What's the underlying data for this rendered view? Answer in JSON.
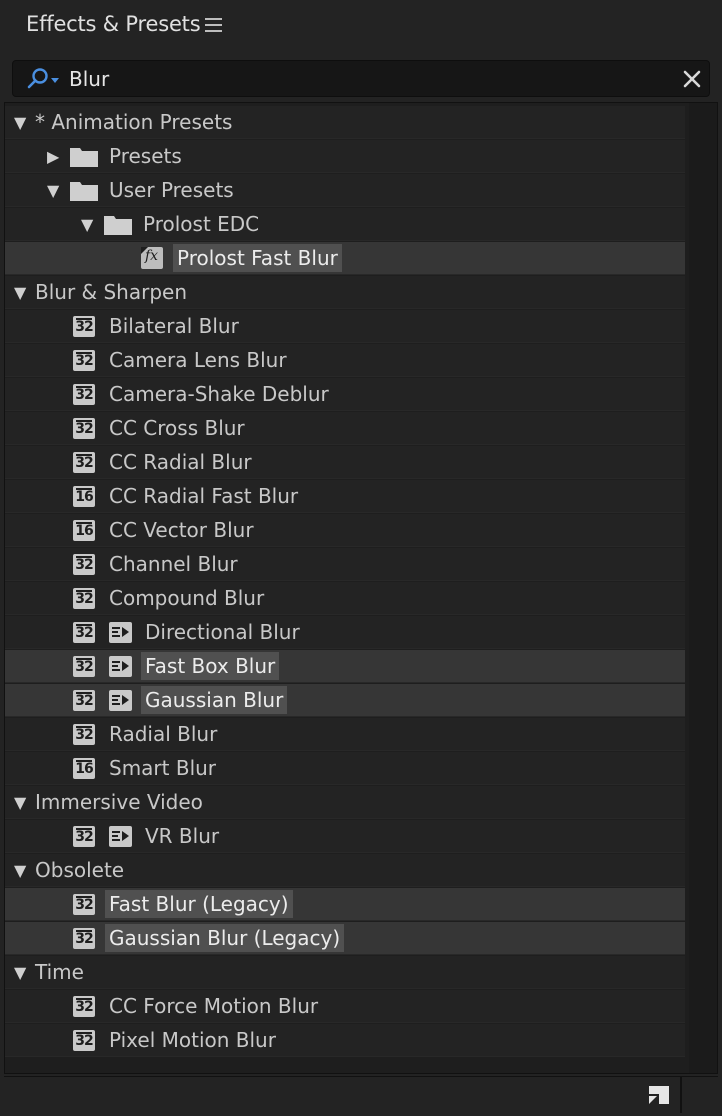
{
  "panel": {
    "title": "Effects & Presets",
    "menu_icon": "hamburger-icon"
  },
  "search": {
    "value": "Blur",
    "icon": "magnifier-dropdown-icon",
    "clear_icon": "close-icon"
  },
  "tree": [
    {
      "kind": "category",
      "label": "* Animation Presets",
      "expanded": true
    },
    {
      "kind": "folder",
      "label": "Presets",
      "expanded": false,
      "depth": 1
    },
    {
      "kind": "folder",
      "label": "User Presets",
      "expanded": true,
      "depth": 1
    },
    {
      "kind": "folder",
      "label": "Prolost EDC",
      "expanded": true,
      "depth": 2
    },
    {
      "kind": "preset",
      "label": "Prolost Fast Blur",
      "depth": 3,
      "selected": true
    },
    {
      "kind": "category",
      "label": "Blur & Sharpen",
      "expanded": true
    },
    {
      "kind": "effect",
      "label": "Bilateral Blur",
      "bpc": "32",
      "gpu": false
    },
    {
      "kind": "effect",
      "label": "Camera Lens Blur",
      "bpc": "32",
      "gpu": false
    },
    {
      "kind": "effect",
      "label": "Camera-Shake Deblur",
      "bpc": "32",
      "gpu": false
    },
    {
      "kind": "effect",
      "label": "CC Cross Blur",
      "bpc": "32",
      "gpu": false
    },
    {
      "kind": "effect",
      "label": "CC Radial Blur",
      "bpc": "32",
      "gpu": false
    },
    {
      "kind": "effect",
      "label": "CC Radial Fast Blur",
      "bpc": "16",
      "gpu": false
    },
    {
      "kind": "effect",
      "label": "CC Vector Blur",
      "bpc": "16",
      "gpu": false
    },
    {
      "kind": "effect",
      "label": "Channel Blur",
      "bpc": "32",
      "gpu": false
    },
    {
      "kind": "effect",
      "label": "Compound Blur",
      "bpc": "32",
      "gpu": false
    },
    {
      "kind": "effect",
      "label": "Directional Blur",
      "bpc": "32",
      "gpu": true
    },
    {
      "kind": "effect",
      "label": "Fast Box Blur",
      "bpc": "32",
      "gpu": true,
      "selected": true
    },
    {
      "kind": "effect",
      "label": "Gaussian Blur",
      "bpc": "32",
      "gpu": true,
      "selected": true
    },
    {
      "kind": "effect",
      "label": "Radial Blur",
      "bpc": "32",
      "gpu": false
    },
    {
      "kind": "effect",
      "label": "Smart Blur",
      "bpc": "16",
      "gpu": false
    },
    {
      "kind": "category",
      "label": "Immersive Video",
      "expanded": true
    },
    {
      "kind": "effect",
      "label": "VR Blur",
      "bpc": "32",
      "gpu": true
    },
    {
      "kind": "category",
      "label": "Obsolete",
      "expanded": true
    },
    {
      "kind": "effect",
      "label": "Fast Blur (Legacy)",
      "bpc": "32",
      "gpu": false,
      "selected": true
    },
    {
      "kind": "effect",
      "label": "Gaussian Blur (Legacy)",
      "bpc": "32",
      "gpu": false,
      "selected": true
    },
    {
      "kind": "category",
      "label": "Time",
      "expanded": true
    },
    {
      "kind": "effect",
      "label": "CC Force Motion Blur",
      "bpc": "32",
      "gpu": false
    },
    {
      "kind": "effect",
      "label": "Pixel Motion Blur",
      "bpc": "32",
      "gpu": false
    }
  ],
  "footer": {
    "new_folder_icon": "new-preset-folder-icon"
  }
}
